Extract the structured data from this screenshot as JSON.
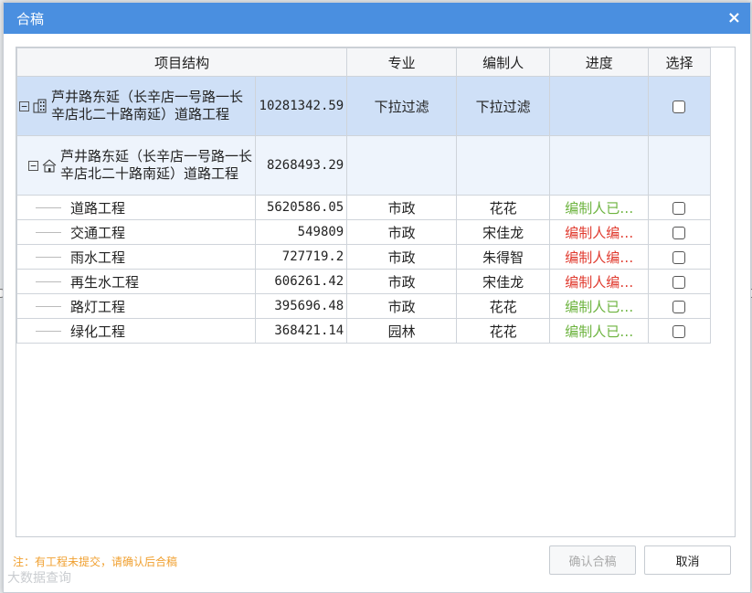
{
  "dialog": {
    "title": "合稿",
    "close_glyph": "×"
  },
  "table": {
    "headers": [
      "项目结构",
      "专业",
      "编制人",
      "进度",
      "选择"
    ],
    "rows": [
      {
        "name": "芦井路东延（长辛店一号路一长辛店北二十路南延）道路工程",
        "amount": "10281342.59",
        "major": "下拉过滤",
        "editor": "下拉过滤",
        "progress": "",
        "level": 0,
        "icon": "building-icon"
      },
      {
        "name": "芦井路东延（长辛店一号路一长辛店北二十路南延）道路工程",
        "amount": "8268493.29",
        "major": "",
        "editor": "",
        "progress": "",
        "level": 1,
        "icon": "home-icon"
      },
      {
        "name": "道路工程",
        "amount": "5620586.05",
        "major": "市政",
        "editor": "花花",
        "progress": "编制人已…",
        "status": "green"
      },
      {
        "name": "交通工程",
        "amount": "549809",
        "major": "市政",
        "editor": "宋佳龙",
        "progress": "编制人编…",
        "status": "red"
      },
      {
        "name": "雨水工程",
        "amount": "727719.2",
        "major": "市政",
        "editor": "朱得智",
        "progress": "编制人编…",
        "status": "red"
      },
      {
        "name": "再生水工程",
        "amount": "606261.42",
        "major": "市政",
        "editor": "宋佳龙",
        "progress": "编制人编…",
        "status": "red"
      },
      {
        "name": "路灯工程",
        "amount": "395696.48",
        "major": "市政",
        "editor": "花花",
        "progress": "编制人已…",
        "status": "green"
      },
      {
        "name": "绿化工程",
        "amount": "368421.14",
        "major": "园林",
        "editor": "花花",
        "progress": "编制人已…",
        "status": "green"
      }
    ]
  },
  "footer": {
    "note": "注：有工程未提交，请确认后合稿",
    "confirm_label": "确认合稿",
    "cancel_label": "取消",
    "watermark": "大数据查询"
  },
  "colors": {
    "titlebar": "#4a8fe0",
    "selected_row": "#cfe0f7",
    "status_green": "#6cb33e",
    "status_red": "#e03a2e",
    "note": "#f0a030"
  }
}
